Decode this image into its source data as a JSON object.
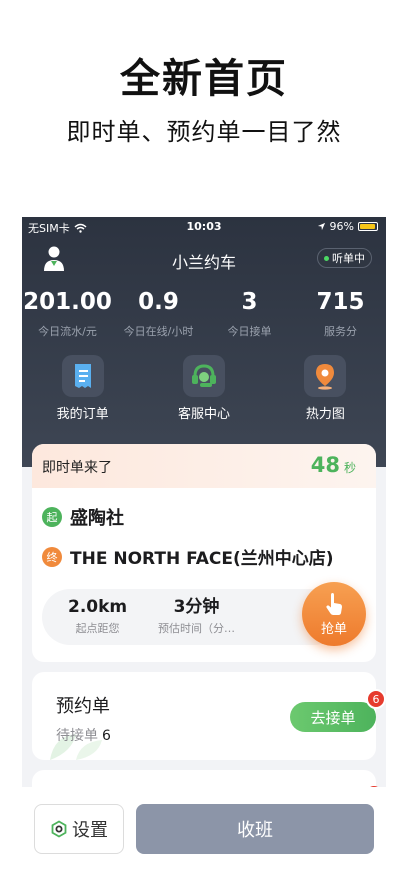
{
  "promo": {
    "title": "全新首页",
    "subtitle": "即时单、预约单一目了然"
  },
  "status_bar": {
    "carrier": "无SIM卡",
    "time": "10:03",
    "battery": "96%",
    "icons": [
      "wifi-icon",
      "location-arrow-icon",
      "battery-icon"
    ]
  },
  "navbar": {
    "title": "小兰约车",
    "listening_badge": "听单中",
    "avatar_icon": "driver-avatar-icon"
  },
  "stats": [
    {
      "value": "201.00",
      "label": "今日流水/元"
    },
    {
      "value": "0.9",
      "label": "今日在线/小时"
    },
    {
      "value": "3",
      "label": "今日接单"
    },
    {
      "value": "715",
      "label": "服务分"
    }
  ],
  "shortcuts": [
    {
      "label": "我的订单",
      "icon": "receipt-icon"
    },
    {
      "label": "客服中心",
      "icon": "headset-icon"
    },
    {
      "label": "热力图",
      "icon": "map-pin-icon"
    }
  ],
  "instant_order": {
    "title": "即时单来了",
    "countdown": "48",
    "countdown_unit": "秒",
    "start_tag": "起",
    "start_address": "盛陶社",
    "end_tag": "终",
    "end_address": "THE NORTH FACE(兰州中心店)",
    "distance_value": "2.0km",
    "distance_label": "起点距您",
    "eta_value": "3分钟",
    "eta_label": "预估时间（分…",
    "grab_label": "抢单"
  },
  "reservation": {
    "title": "预约单",
    "pending_label": "待接单",
    "pending_count": "6",
    "action_label": "去接单",
    "badge_count": "6"
  },
  "bottom": {
    "settings_label": "设置",
    "off_work_label": "收班"
  },
  "colors": {
    "header_dark": "#2c3340",
    "accent_green": "#4db35c",
    "accent_orange": "#f08a3c",
    "badge_red": "#e63b2e",
    "off_work_gray": "#8c95a8"
  }
}
